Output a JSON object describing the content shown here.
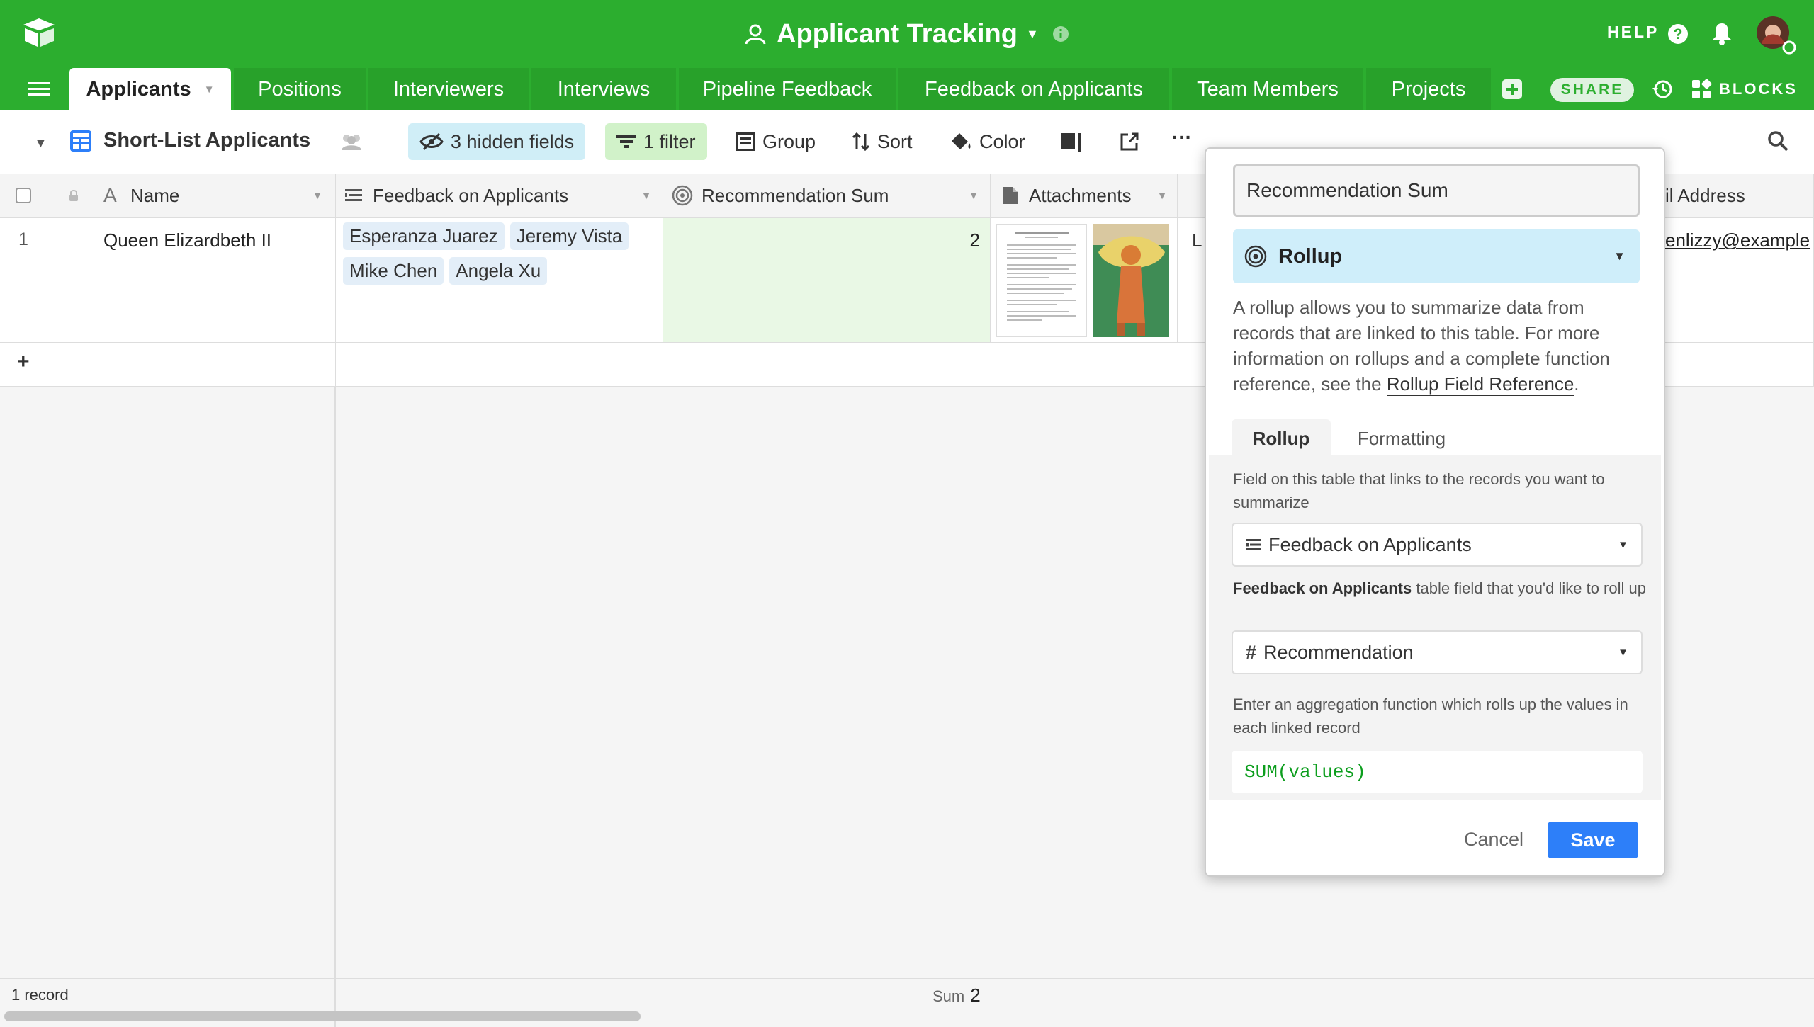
{
  "header": {
    "base_title": "Applicant Tracking",
    "help_label": "HELP",
    "share_label": "SHARE",
    "blocks_label": "BLOCKS"
  },
  "tabs": [
    {
      "label": "Applicants",
      "active": true
    },
    {
      "label": "Positions"
    },
    {
      "label": "Interviewers"
    },
    {
      "label": "Interviews"
    },
    {
      "label": "Pipeline Feedback"
    },
    {
      "label": "Feedback on Applicants"
    },
    {
      "label": "Team Members"
    },
    {
      "label": "Projects"
    }
  ],
  "toolbar": {
    "view_name": "Short-List Applicants",
    "hidden_fields": "3 hidden fields",
    "filter": "1 filter",
    "group": "Group",
    "sort": "Sort",
    "color": "Color",
    "more": "···"
  },
  "columns": {
    "name": "Name",
    "feedback": "Feedback on Applicants",
    "rec_sum": "Recommendation Sum",
    "attachments": "Attachments",
    "email": "il Address"
  },
  "rows": [
    {
      "num": "1",
      "name": "Queen Elizardbeth II",
      "feedback": [
        "Esperanza Juarez",
        "Jeremy Vista",
        "Mike Chen",
        "Angela Xu"
      ],
      "rec_sum": "2",
      "partial_l": "L",
      "email": "enlizzy@example"
    }
  ],
  "add_row": "+",
  "footer": {
    "records": "1 record",
    "sum_label": "Sum",
    "sum_value": "2"
  },
  "dialog": {
    "field_name": "Recommendation Sum",
    "field_type": "Rollup",
    "description_pre": "A rollup allows you to summarize data from records that are linked to this table. For more information on rollups and a complete function reference, see the ",
    "description_link": "Rollup Field Reference",
    "description_post": ".",
    "tab_rollup": "Rollup",
    "tab_formatting": "Formatting",
    "link_field_label": "Field on this table that links to the records you want to summarize",
    "link_field_value": "Feedback on Applicants",
    "rollup_field_label_bold": "Feedback on Applicants",
    "rollup_field_label_rest": " table field that you'd like to roll up",
    "rollup_field_value": "Recommendation",
    "agg_label": "Enter an aggregation function which rolls up the values in each linked record",
    "agg_value": "SUM(values)",
    "cancel": "Cancel",
    "save": "Save"
  },
  "colors": {
    "brand_green": "#2cae2f",
    "save_blue": "#2d7ff9",
    "rollup_bg": "#cfeefa",
    "formula_green": "#0d9e1e"
  }
}
